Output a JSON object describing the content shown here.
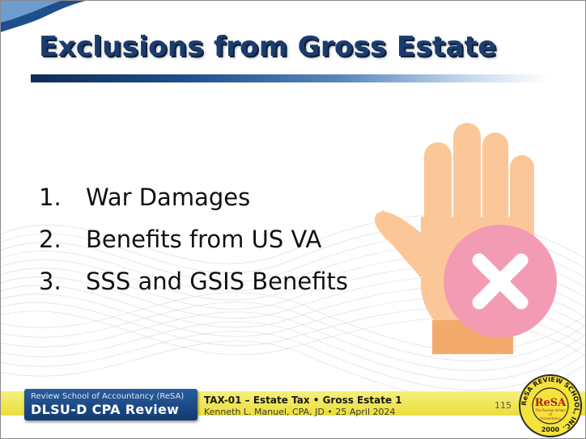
{
  "slide": {
    "title": "Exclusions from Gross Estate",
    "items": [
      {
        "number": "1.",
        "text": "War Damages"
      },
      {
        "number": "2.",
        "text": "Benefits from US VA"
      },
      {
        "number": "3.",
        "text": "SSS and GSIS Benefits"
      }
    ],
    "graphic": {
      "icon": "stop-hand-with-x-icon"
    }
  },
  "footer": {
    "school": "Review School of Accountancy (ReSA)",
    "program": "DLSU-D CPA Review",
    "course": "TAX-01 – Estate Tax • Gross Estate 1",
    "lecturer": "Kenneth L. Manuel, CPA, JD • 25 April 2024",
    "page_number": "115",
    "seal": {
      "ring_text": "ReSA REVIEW SCHOOL, INC.",
      "center": "ReSA",
      "subtext_1": "The Review School",
      "subtext_2": "of",
      "subtext_3": "Accountancy",
      "year": "2000"
    }
  },
  "colors": {
    "title": "#1b3c6e",
    "accent_blue": "#123a72",
    "footer_yellow": "#ece23f",
    "hand_skin": "#fbc798",
    "x_badge": "#f49bb4"
  }
}
